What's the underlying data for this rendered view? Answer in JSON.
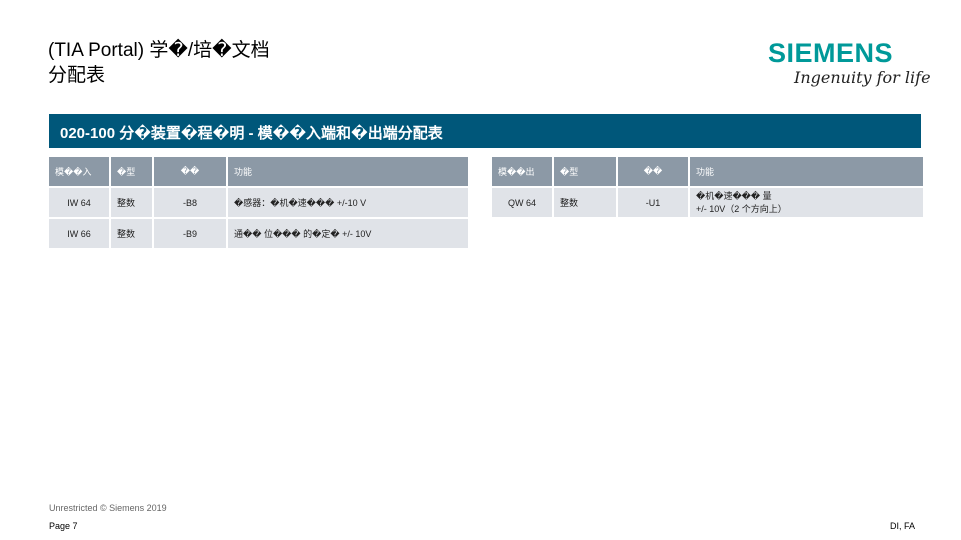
{
  "header": {
    "title_line1": "(TIA Portal) 学�/培�文档",
    "title_line2": "分配表"
  },
  "logo": {
    "wordmark": "SIEMENS",
    "tagline": "Ingenuity for life",
    "color": "#009999"
  },
  "banner": {
    "text": "020-100 分�装置�程�明 - 模��入端和�出端分配表",
    "color": "#00577a"
  },
  "left_table": {
    "headers": [
      "模��入",
      "�型",
      "��",
      "功能"
    ],
    "rows": [
      [
        "IW 64",
        "整数",
        "-B8",
        "�感器：�机�速��� +/-10 V"
      ],
      [
        "IW 66",
        "整数",
        "-B9",
        "通�� 位��� 的�定� +/- 10V"
      ]
    ]
  },
  "right_table": {
    "headers": [
      "模��出",
      "�型",
      "��",
      "功能"
    ],
    "rows": [
      [
        "QW 64",
        "整数",
        "-U1",
        "�机�速��� 量",
        "+/- 10V（2 个方向上）"
      ]
    ]
  },
  "footer": {
    "note": "Unrestricted © Siemens 2019",
    "page": "Page 7",
    "department": "DI, FA"
  }
}
